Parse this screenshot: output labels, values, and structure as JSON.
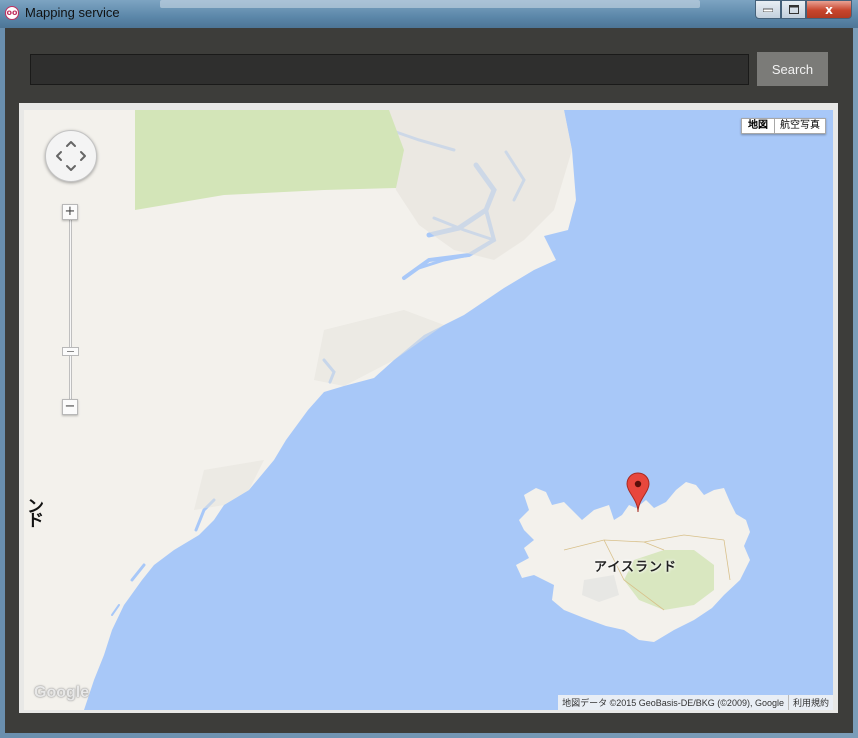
{
  "window": {
    "title": "Mapping service",
    "icon": "app-logo-icon",
    "controls": {
      "minimize_icon": "minimize-icon",
      "maximize_icon": "maximize-icon",
      "close_icon": "close-icon",
      "close_glyph": "x"
    }
  },
  "search": {
    "value": "",
    "placeholder": "",
    "button_label": "Search"
  },
  "map": {
    "type_controls": {
      "map": "地図",
      "satellite": "航空写真",
      "selected": "map"
    },
    "labels": {
      "iceland": "アイスランド",
      "greenland_partial": "ンド"
    },
    "zoom": {
      "in_glyph": "+",
      "out_glyph": "−"
    },
    "marker": {
      "icon": "map-pin-icon",
      "color": "#e8473d"
    },
    "attribution": "地図データ ©2015 GeoBasis-DE/BKG (©2009), Google",
    "terms": "利用規約",
    "logo": "Google"
  },
  "colors": {
    "water": "#a8c8f8",
    "land": "#f3f1ec",
    "park": "#d3e5b8",
    "toolbar_bg": "#3d3d3a",
    "button_bg": "#7b7b78"
  }
}
